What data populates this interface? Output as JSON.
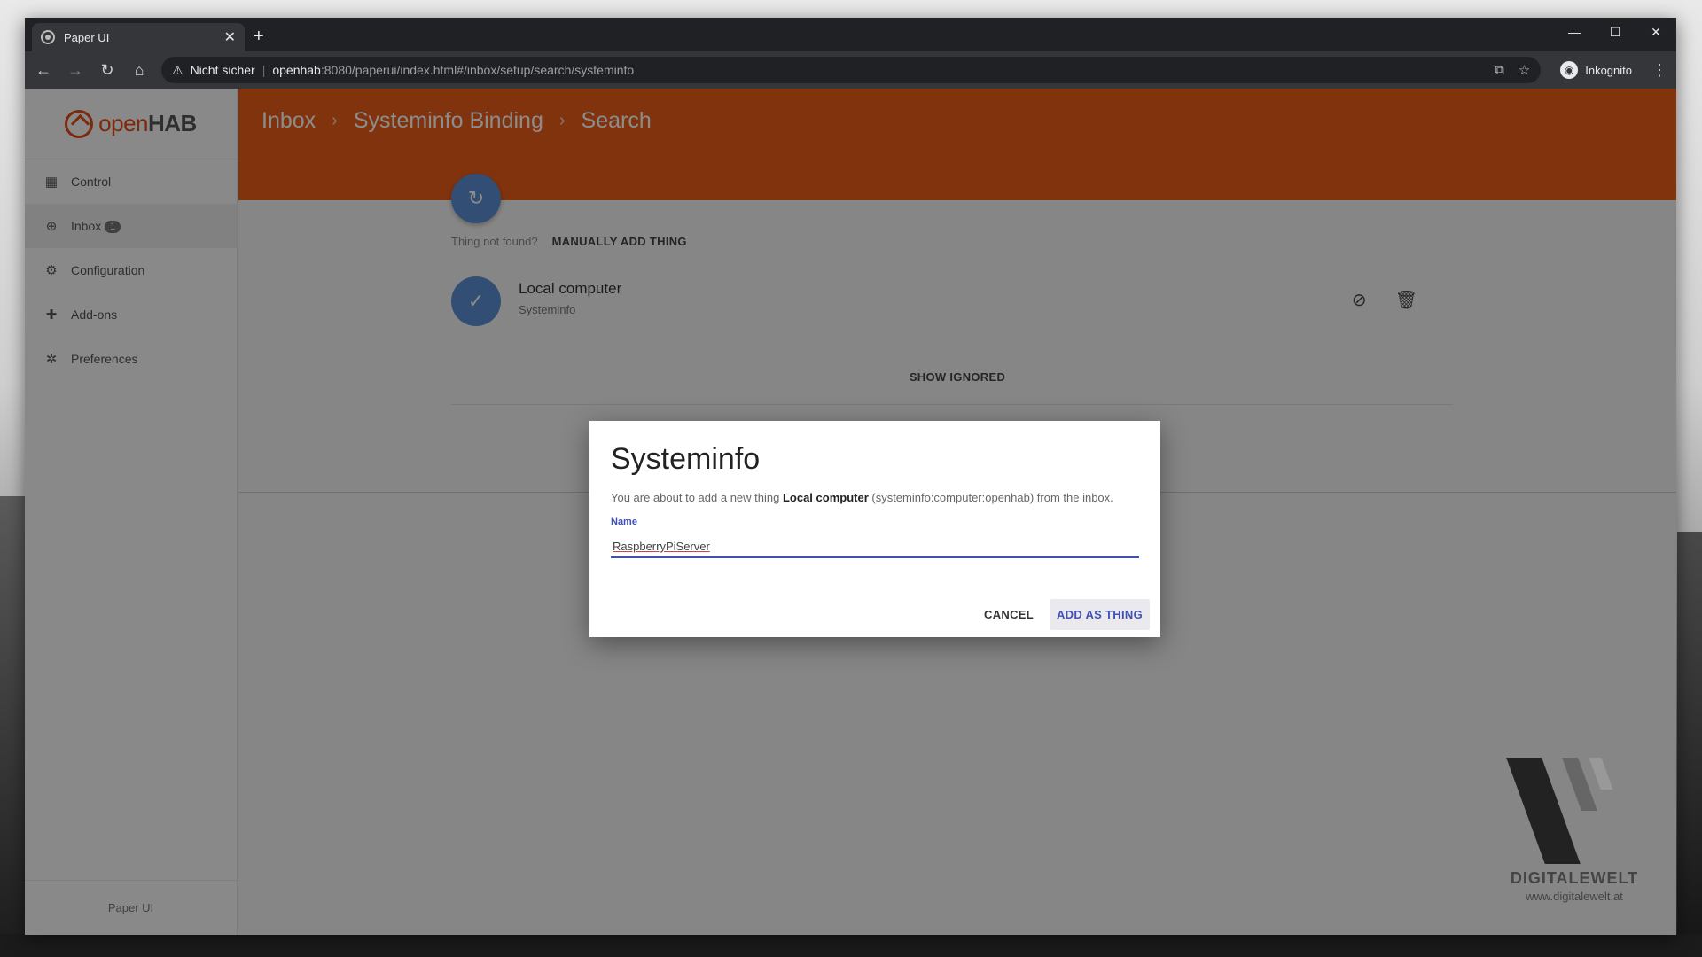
{
  "browser": {
    "tab_title": "Paper UI",
    "tab_close": "✕",
    "new_tab": "+",
    "window_controls": [
      "—",
      "☐",
      "✕"
    ],
    "not_secure": "Nicht sicher",
    "url_host": "openhab",
    "url_rest": ":8080/paperui/index.html#/inbox/setup/search/systeminfo",
    "incognito_label": "Inkognito"
  },
  "sidebar": {
    "logo_text_a": "open",
    "logo_text_b": "HAB",
    "items": [
      {
        "label": "Control",
        "icon": "dashboard-icon"
      },
      {
        "label": "Inbox",
        "icon": "inbox-icon",
        "badge": "1"
      },
      {
        "label": "Configuration",
        "icon": "gear-icon"
      },
      {
        "label": "Add-ons",
        "icon": "puzzle-icon"
      },
      {
        "label": "Preferences",
        "icon": "preferences-icon"
      }
    ],
    "footer": "Paper UI"
  },
  "header": {
    "breadcrumb": [
      "Inbox",
      "Systeminfo Binding",
      "Search"
    ],
    "separator": "›"
  },
  "content": {
    "not_found_label": "Thing not found?",
    "manual_add_label": "MANUALLY ADD THING",
    "thing": {
      "title": "Local computer",
      "subtitle": "Systeminfo"
    },
    "show_ignored_label": "SHOW IGNORED"
  },
  "dialog": {
    "title": "Systeminfo",
    "text_prefix": "You are about to add a new thing ",
    "text_bold": "Local computer",
    "text_suffix": " (systeminfo:computer:openhab) from the inbox.",
    "field_label": "Name",
    "field_value": "RaspberryPiServer",
    "cancel_label": "CANCEL",
    "add_label": "ADD AS THING"
  },
  "watermark": {
    "name": "DIGITALEWELT",
    "url": "www.digitalewelt.at"
  },
  "colors": {
    "accent_orange": "#ec5e1a",
    "fab_blue": "#5b8fd3",
    "primary_indigo": "#3f51b5"
  }
}
